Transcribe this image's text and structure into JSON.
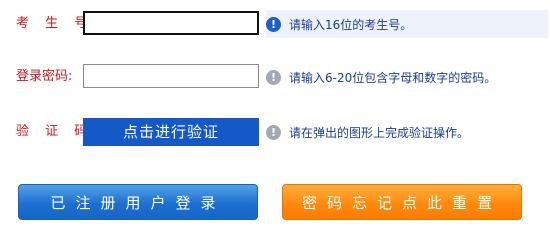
{
  "form": {
    "exam_no": {
      "label": "考 生 号:",
      "value": "",
      "hint_icon": "info-icon",
      "hint": "请输入16位的考生号。"
    },
    "password": {
      "label": "登录密码:",
      "value": "",
      "hint_icon": "info-icon",
      "hint": "请输入6-20位包含字母和数字的密码。"
    },
    "captcha": {
      "label": "验 证 码:",
      "button_label": "点击进行验证",
      "hint_icon": "info-icon",
      "hint": "请在弹出的图形上完成验证操作。"
    }
  },
  "buttons": {
    "login": "已注册用户登录",
    "reset": "密码忘记点此重置"
  },
  "colors": {
    "label_red": "#c8191f",
    "hint_blue": "#1a3d8f",
    "verify_blue": "#1559c8",
    "login_blue": "#1d6fd1",
    "reset_orange": "#ff8a0e"
  }
}
